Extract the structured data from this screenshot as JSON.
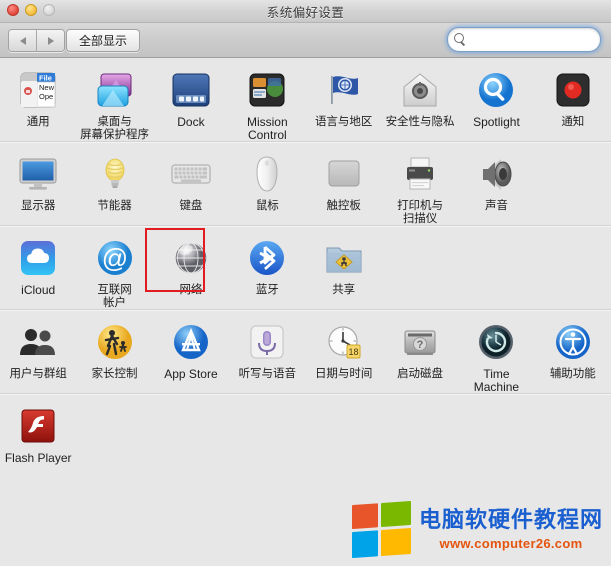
{
  "window": {
    "title": "系统偏好设置",
    "traffic_lights": [
      "close-red",
      "minimize-yellow",
      "zoom-disabled-gray"
    ]
  },
  "toolbar": {
    "back_label": "◀",
    "forward_label": "▶",
    "show_all_label": "全部显示",
    "search": {
      "value": "",
      "placeholder": "",
      "icon": "search-icon"
    }
  },
  "colors": {
    "highlight_box": "#e11b22",
    "search_focus": "#6ea0e1",
    "watermark_text": "#1a5fd0",
    "watermark_url": "#e4550f",
    "wm_orange": "#e8552a",
    "wm_green": "#7ab800",
    "wm_blue": "#00a2e8",
    "wm_yellow": "#ffb900"
  },
  "rows": [
    {
      "name": "personal",
      "items": [
        {
          "label": "通用",
          "icon": "general-icon",
          "latin": false
        },
        {
          "label": "桌面与\n屏幕保护程序",
          "icon": "desktop-screensaver-icon",
          "latin": false
        },
        {
          "label": "Dock",
          "icon": "dock-icon",
          "latin": true
        },
        {
          "label": "Mission\nControl",
          "icon": "mission-control-icon",
          "latin": true
        },
        {
          "label": "语言与地区",
          "icon": "language-region-icon",
          "latin": false
        },
        {
          "label": "安全性与隐私",
          "icon": "security-privacy-icon",
          "latin": false
        },
        {
          "label": "Spotlight",
          "icon": "spotlight-icon",
          "latin": true
        },
        {
          "label": "通知",
          "icon": "notifications-icon",
          "latin": false
        }
      ]
    },
    {
      "name": "hardware",
      "items": [
        {
          "label": "显示器",
          "icon": "displays-icon",
          "latin": false
        },
        {
          "label": "节能器",
          "icon": "energy-saver-icon",
          "latin": false
        },
        {
          "label": "键盘",
          "icon": "keyboard-icon",
          "latin": false
        },
        {
          "label": "鼠标",
          "icon": "mouse-icon",
          "latin": false
        },
        {
          "label": "触控板",
          "icon": "trackpad-icon",
          "latin": false
        },
        {
          "label": "打印机与\n扫描仪",
          "icon": "printers-scanners-icon",
          "latin": false
        },
        {
          "label": "声音",
          "icon": "sound-icon",
          "latin": false
        }
      ]
    },
    {
      "name": "internet-wireless",
      "items": [
        {
          "label": "iCloud",
          "icon": "icloud-icon",
          "latin": true
        },
        {
          "label": "互联网\n帐户",
          "icon": "internet-accounts-icon",
          "latin": false
        },
        {
          "label": "网络",
          "icon": "network-icon",
          "latin": false,
          "highlighted": true
        },
        {
          "label": "蓝牙",
          "icon": "bluetooth-icon",
          "latin": false
        },
        {
          "label": "共享",
          "icon": "sharing-icon",
          "latin": false
        }
      ]
    },
    {
      "name": "system",
      "items": [
        {
          "label": "用户与群组",
          "icon": "users-groups-icon",
          "latin": false
        },
        {
          "label": "家长控制",
          "icon": "parental-controls-icon",
          "latin": false
        },
        {
          "label": "App Store",
          "icon": "app-store-icon",
          "latin": true
        },
        {
          "label": "听写与语音",
          "icon": "dictation-speech-icon",
          "latin": false
        },
        {
          "label": "日期与时间",
          "icon": "date-time-icon",
          "latin": false
        },
        {
          "label": "启动磁盘",
          "icon": "startup-disk-icon",
          "latin": false
        },
        {
          "label": "Time Machine",
          "icon": "time-machine-icon",
          "latin": true
        },
        {
          "label": "辅助功能",
          "icon": "accessibility-icon",
          "latin": false
        }
      ]
    },
    {
      "name": "other",
      "items": [
        {
          "label": "Flash Player",
          "icon": "flash-player-icon",
          "latin": true
        }
      ]
    }
  ],
  "watermark": {
    "site_name": "电脑软硬件教程网",
    "url": "www.computer26.com"
  }
}
